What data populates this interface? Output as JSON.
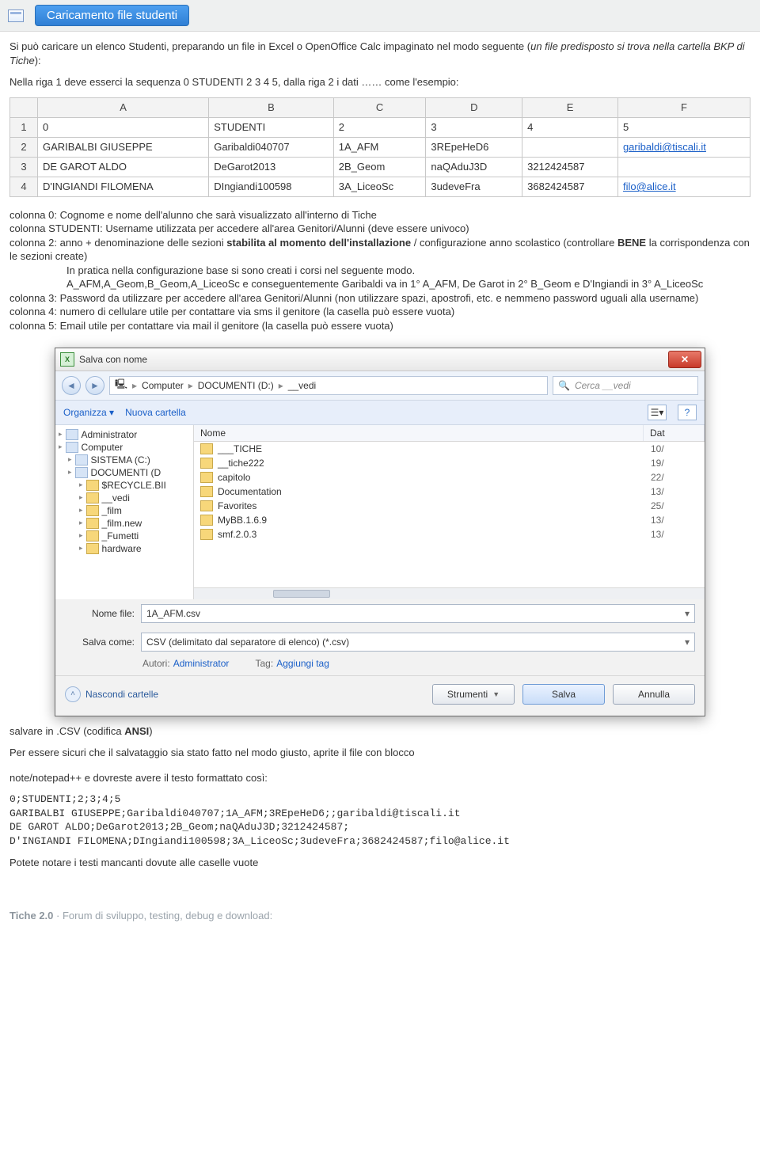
{
  "header_button": "Caricamento file studenti",
  "intro": {
    "p1a": "Si può caricare un elenco Studenti, preparando un file in Excel o OpenOffice Calc impaginato nel modo seguente (",
    "p1b": "un file predisposto si trova nella cartella BKP di Tiche",
    "p1c": "):",
    "p2": "Nella riga 1 deve esserci la sequenza 0 STUDENTI 2 3 4 5, dalla riga 2 i dati …… come l'esempio:"
  },
  "sheet": {
    "cols": [
      "A",
      "B",
      "C",
      "D",
      "E",
      "F"
    ],
    "rows": [
      {
        "n": "1",
        "cells": [
          "0",
          "STUDENTI",
          "2",
          "3",
          "4",
          "5"
        ]
      },
      {
        "n": "2",
        "cells": [
          "GARIBALBI GIUSEPPE",
          "Garibaldi040707",
          "1A_AFM",
          "3REpeHeD6",
          "",
          "garibaldi@tiscali.it"
        ],
        "link_idx": 5
      },
      {
        "n": "3",
        "cells": [
          "DE GAROT ALDO",
          "DeGarot2013",
          "2B_Geom",
          "naQAduJ3D",
          "3212424587",
          ""
        ]
      },
      {
        "n": "4",
        "cells": [
          "D'INGIANDI FILOMENA",
          "DIngiandi100598",
          "3A_LiceoSc",
          "3udeveFra",
          "3682424587",
          "filo@alice.it"
        ],
        "link_idx": 5
      }
    ]
  },
  "coldesc": {
    "c0": "colonna 0: Cognome e nome dell'alunno che sarà visualizzato all'interno di Tiche",
    "c1": "colonna STUDENTI: Username utilizzata per accedere all'area Genitori/Alunni (deve essere univoco)",
    "c2a": "colonna 2: anno + denominazione delle sezioni ",
    "c2b": "stabilita al momento dell'installazione",
    "c2c": " / configurazione anno scolastico (controllare ",
    "c2d": "BENE",
    "c2e": " la corrispondenza con le sezioni create)",
    "c2f": "In pratica nella configurazione base si sono creati i corsi nel seguente modo.",
    "c2g": "A_AFM,A_Geom,B_Geom,A_LiceoSc e conseguentemente Garibaldi va in 1° A_AFM, De Garot in 2° B_Geom e D'Ingiandi in 3° A_LiceoSc",
    "c3": "colonna 3: Password da utilizzare per accedere all'area Genitori/Alunni (non utilizzare spazi, apostrofi, etc. e nemmeno password uguali alla username)",
    "c4": "colonna 4: numero di cellulare utile per contattare via sms il genitore (la casella può essere vuota)",
    "c5": "colonna 5: Email utile per contattare via mail il genitore (la casella può essere vuota)"
  },
  "dialog": {
    "title": "Salva con nome",
    "breadcrumb": [
      "Computer",
      "DOCUMENTI (D:)",
      "__vedi"
    ],
    "search_placeholder": "Cerca __vedi",
    "organize": "Organizza",
    "new_folder": "Nuova cartella",
    "tree": [
      {
        "label": "Administrator",
        "cls": "ico sys",
        "ind": ""
      },
      {
        "label": "Computer",
        "cls": "ico sys",
        "ind": ""
      },
      {
        "label": "SISTEMA (C:)",
        "cls": "ico sys",
        "ind": "ind1"
      },
      {
        "label": "DOCUMENTI (D",
        "cls": "ico sys",
        "ind": "ind1"
      },
      {
        "label": "$RECYCLE.BII",
        "cls": "ico",
        "ind": "ind2"
      },
      {
        "label": "__vedi",
        "cls": "ico",
        "ind": "ind2"
      },
      {
        "label": "_film",
        "cls": "ico",
        "ind": "ind2"
      },
      {
        "label": "_film.new",
        "cls": "ico",
        "ind": "ind2"
      },
      {
        "label": "_Fumetti",
        "cls": "ico",
        "ind": "ind2"
      },
      {
        "label": "hardware",
        "cls": "ico",
        "ind": "ind2"
      }
    ],
    "fp_head_name": "Nome",
    "fp_head_date": "Dat",
    "files": [
      {
        "name": "___TICHE",
        "date": "10/"
      },
      {
        "name": "__tiche222",
        "date": "19/"
      },
      {
        "name": "capitolo",
        "date": "22/"
      },
      {
        "name": "Documentation",
        "date": "13/"
      },
      {
        "name": "Favorites",
        "date": "25/"
      },
      {
        "name": "MyBB.1.6.9",
        "date": "13/"
      },
      {
        "name": "smf.2.0.3",
        "date": "13/"
      }
    ],
    "filename_label": "Nome file:",
    "filename_value": "1A_AFM.csv",
    "savetype_label": "Salva come:",
    "savetype_value": "CSV (delimitato dal separatore di elenco) (*.csv)",
    "author_k": "Autori:",
    "author_v": "Administrator",
    "tag_k": "Tag:",
    "tag_v": "Aggiungi tag",
    "hide_folders": "Nascondi cartelle",
    "tools": "Strumenti",
    "save": "Salva",
    "cancel": "Annulla"
  },
  "after": {
    "p1a": "salvare in .CSV (codifica ",
    "p1b": "ANSI",
    "p1c": ")",
    "p2": "Per essere sicuri che il salvataggio sia stato fatto nel modo giusto, aprite il file con blocco",
    "p3": "note/notepad++ e dovreste avere il testo formattato così:",
    "mono": "0;STUDENTI;2;3;4;5\nGARIBALBI GIUSEPPE;Garibaldi040707;1A_AFM;3REpeHeD6;;garibaldi@tiscali.it\nDE GAROT ALDO;DeGarot2013;2B_Geom;naQAduJ3D;3212424587;\nD'INGIANDI FILOMENA;DIngiandi100598;3A_LiceoSc;3udeveFra;3682424587;filo@alice.it",
    "p4": "Potete notare i testi mancanti dovute alle caselle vuote"
  },
  "footer": {
    "b": "Tiche 2.0",
    "rest": " · Forum di sviluppo, testing, debug e download:"
  }
}
